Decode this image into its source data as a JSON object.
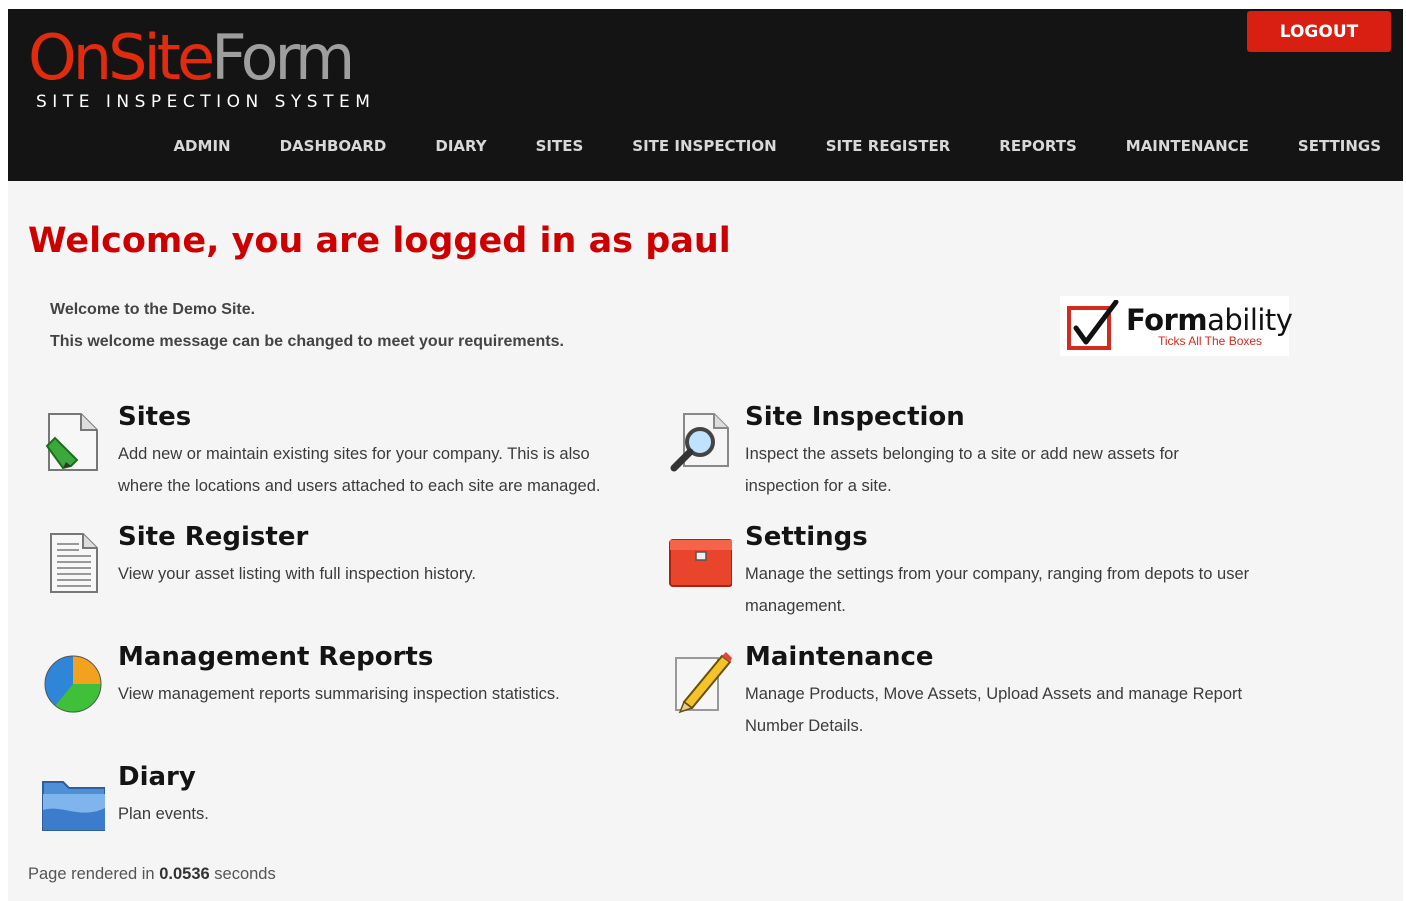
{
  "header": {
    "logo_on": "OnSite",
    "logo_form": "Form",
    "logo_sub": "SITE INSPECTION SYSTEM",
    "logout_label": "LOGOUT",
    "nav": [
      "ADMIN",
      "DASHBOARD",
      "DIARY",
      "SITES",
      "SITE INSPECTION",
      "SITE REGISTER",
      "REPORTS",
      "MAINTENANCE",
      "SETTINGS"
    ]
  },
  "main": {
    "welcome_title": "Welcome, you are logged in as paul",
    "messages": [
      "Welcome to the Demo Site.",
      "This welcome message can be changed to meet your requirements."
    ],
    "badge": {
      "name_bold": "Form",
      "name_light": "ability",
      "tagline": "Ticks All The Boxes"
    },
    "items": [
      {
        "title": "Sites",
        "desc": "Add new or maintain existing sites for your company. This is also where the locations and users attached to each site are managed.",
        "icon": "document-edit-icon"
      },
      {
        "title": "Site Inspection",
        "desc": "Inspect the assets belonging to a site or add new assets for inspection for a site.",
        "icon": "magnifier-document-icon"
      },
      {
        "title": "Site Register",
        "desc": "View your asset listing with full inspection history.",
        "icon": "text-document-icon"
      },
      {
        "title": "Settings",
        "desc": "Manage the settings from your company, ranging from depots to user management.",
        "icon": "toolbox-icon"
      },
      {
        "title": "Management Reports",
        "desc": "View management reports summarising inspection statistics.",
        "icon": "pie-chart-icon"
      },
      {
        "title": "Maintenance",
        "desc": "Manage Products, Move Assets, Upload Assets and manage Report Number Details.",
        "icon": "pencil-note-icon"
      },
      {
        "title": "Diary",
        "desc": "Plan events.",
        "icon": "folder-icon"
      }
    ]
  },
  "footer": {
    "prefix": "Page rendered in",
    "time": "0.0536",
    "suffix": "seconds"
  },
  "colors": {
    "header_bg": "#141414",
    "brand_red": "#e02b0f",
    "title_red": "#cc0000",
    "logout_bg": "#d91e12",
    "page_bg": "#f5f5f5"
  }
}
